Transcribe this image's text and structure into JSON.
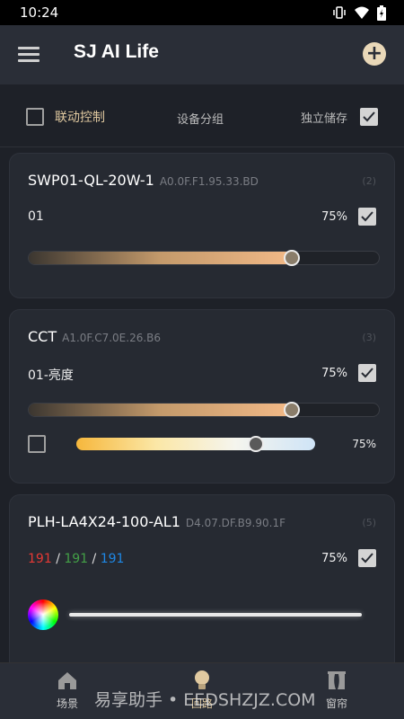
{
  "status": {
    "time": "10:24"
  },
  "app": {
    "title": "SJ AI Life"
  },
  "options": {
    "linked_control": "联动控制",
    "device_group": "设备分组",
    "independent_save": "独立储存",
    "linked_checked": false,
    "independent_checked": true
  },
  "cards": [
    {
      "name": "SWP01-QL-20W-1",
      "mac": "A0.0F.F1.95.33.BD",
      "index": "(2)",
      "channel": {
        "label": "01",
        "percent": "75%",
        "value": 0.75,
        "checked": true
      }
    },
    {
      "name": "CCT",
      "mac": "A1.0F.C7.0E.26.B6",
      "index": "(3)",
      "channel": {
        "label": "01-亮度",
        "percent": "75%",
        "value": 0.75,
        "checked": true
      },
      "cct": {
        "percent": "75%",
        "value": 0.75,
        "checked": false
      }
    },
    {
      "name": "PLH-LA4X24-100-AL1",
      "mac": "D4.07.DF.B9.90.1F",
      "index": "(5)",
      "rgb": {
        "r": "191",
        "g": "191",
        "b": "191",
        "sep": "/"
      },
      "percent": "75%",
      "checked": true
    }
  ],
  "nav": {
    "scene": "场景",
    "circuit": "回路",
    "curtain": "窗帘"
  },
  "watermark": "易享助手 • EEDSHZJZ.COM",
  "colors": {
    "accent": "#e0c9a0",
    "background": "#1e2128",
    "card": "#262a32"
  }
}
